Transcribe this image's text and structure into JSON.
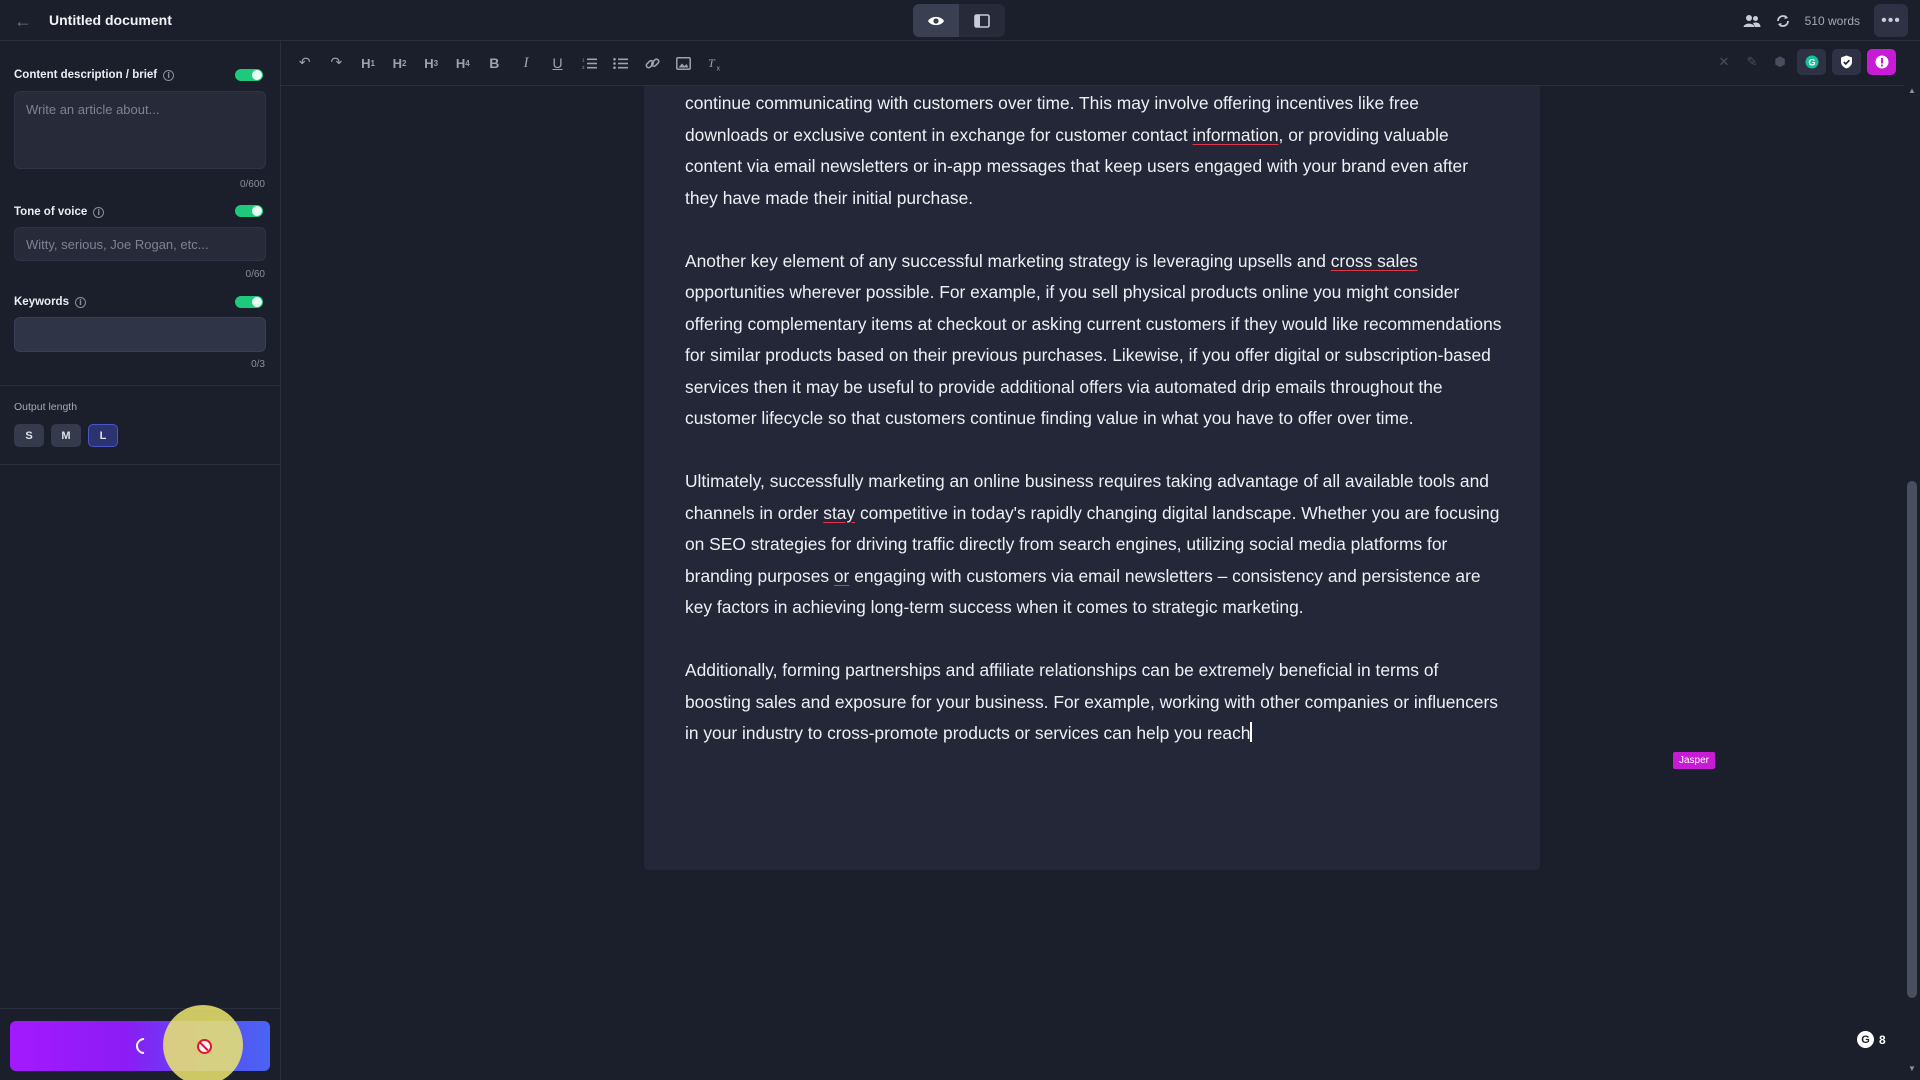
{
  "header": {
    "back_icon": "arrow-left-icon",
    "title": "Untitled document",
    "view_modes": [
      "preview-eye-icon",
      "sidebar-layout-icon"
    ],
    "word_count": "510 words"
  },
  "left_panel": {
    "brief": {
      "label": "Content description / brief",
      "placeholder": "Write an article about...",
      "counter": "0/600",
      "enabled": true
    },
    "tone": {
      "label": "Tone of voice",
      "placeholder": "Witty, serious, Joe Rogan, etc...",
      "counter": "0/60",
      "enabled": true
    },
    "keywords": {
      "label": "Keywords",
      "value": "",
      "counter": "0/3",
      "enabled": true
    },
    "output_length": {
      "label": "Output length",
      "options": [
        "S",
        "M",
        "L"
      ],
      "selected": "L"
    },
    "generate_button": {
      "state": "loading"
    }
  },
  "toolbar": {
    "tools": [
      "undo-icon",
      "redo-icon",
      "heading-1-icon",
      "heading-2-icon",
      "heading-3-icon",
      "heading-4-icon",
      "bold-icon",
      "italic-icon",
      "underline-icon",
      "ordered-list-icon",
      "bullet-list-icon",
      "link-icon",
      "image-icon",
      "clear-format-icon"
    ],
    "heading_labels": [
      "H",
      "H",
      "H",
      "H"
    ],
    "heading_levels": [
      "1",
      "2",
      "3",
      "4"
    ],
    "bold_label": "B",
    "italic_label": "I",
    "underline_label": "U"
  },
  "document": {
    "paragraphs": [
      [
        {
          "t": "continue communicating with customers over time. This may involve offering incentives like free downloads or exclusive content in exchange for customer contact "
        },
        {
          "t": "information",
          "spell": true
        },
        {
          "t": ", or providing valuable content via email newsletters or in-app messages that keep users engaged with your brand even after they have made their initial purchase."
        }
      ],
      [
        {
          "t": "Another key element of any successful marketing strategy is leveraging upsells and "
        },
        {
          "t": "cross sales",
          "spell": true
        },
        {
          "t": " opportunities wherever possible. For example, if you sell physical products online you might consider offering complementary items at checkout or asking current customers if they would like recommendations for similar products based on their previous purchases. Likewise, if you offer digital or subscription-based services then it may be useful to provide additional offers via automated drip emails throughout the customer lifecycle so that customers continue finding value in what you have to offer over time."
        }
      ],
      [
        {
          "t": "Ultimately, successfully marketing an online business requires taking advantage of all available tools and channels in order "
        },
        {
          "t": "stay",
          "spell": true
        },
        {
          "t": " competitive in today's rapidly changing digital landscape. Whether you are focusing on SEO strategies for driving traffic directly from search engines, utilizing social media platforms for branding purposes "
        },
        {
          "t": "or",
          "spell": true
        },
        {
          "t": " engaging with customers via email newsletters – consistency and persistence are key factors in achieving long-term success when it comes to strategic marketing."
        }
      ],
      [
        {
          "t": "Additionally, forming partnerships and affiliate relationships can be extremely beneficial in terms of boosting sales and exposure for your business. For example, working with other companies or influencers in your industry to cross-promote products or services can help you reach"
        }
      ]
    ],
    "cursor_tag": "Jasper"
  },
  "grammarly": {
    "icon": "grammarly-icon",
    "letter": "G",
    "count": "8"
  },
  "colors": {
    "background": "#1b1e2b",
    "card": "#232738",
    "toggle_on": "#1fc97a",
    "jasper_accent": "#c81bd6",
    "generate_gradient_start": "#a419ff",
    "generate_gradient_end": "#4a63f2",
    "spellcheck_underline": "#e0364a"
  }
}
